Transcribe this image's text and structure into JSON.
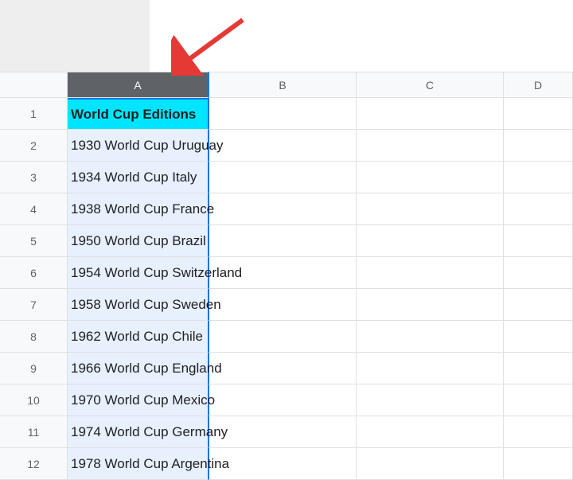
{
  "columns": {
    "a": "A",
    "b": "B",
    "c": "C",
    "d": "D"
  },
  "rowNumbers": [
    "1",
    "2",
    "3",
    "4",
    "5",
    "6",
    "7",
    "8",
    "9",
    "10",
    "11",
    "12"
  ],
  "cells": {
    "header": "World Cup Editions",
    "rows": [
      "1930 World Cup Uruguay",
      "1934 World Cup Italy",
      "1938 World Cup France",
      "1950 World Cup Brazil",
      "1954 World Cup Switzerland",
      "1958 World Cup Sweden",
      "1962 World Cup Chile",
      "1966 World Cup England",
      "1970 World Cup Mexico",
      "1974 World Cup Germany",
      "1978 World Cup Argentina"
    ]
  },
  "chart_data": {
    "type": "table",
    "title": "World Cup Editions",
    "columns": [
      "Edition"
    ],
    "rows": [
      [
        "1930 World Cup Uruguay"
      ],
      [
        "1934 World Cup Italy"
      ],
      [
        "1938 World Cup France"
      ],
      [
        "1950 World Cup Brazil"
      ],
      [
        "1954 World Cup Switzerland"
      ],
      [
        "1958 World Cup Sweden"
      ],
      [
        "1962 World Cup Chile"
      ],
      [
        "1966 World Cup England"
      ],
      [
        "1970 World Cup Mexico"
      ],
      [
        "1974 World Cup Germany"
      ],
      [
        "1978 World Cup Argentina"
      ]
    ]
  }
}
